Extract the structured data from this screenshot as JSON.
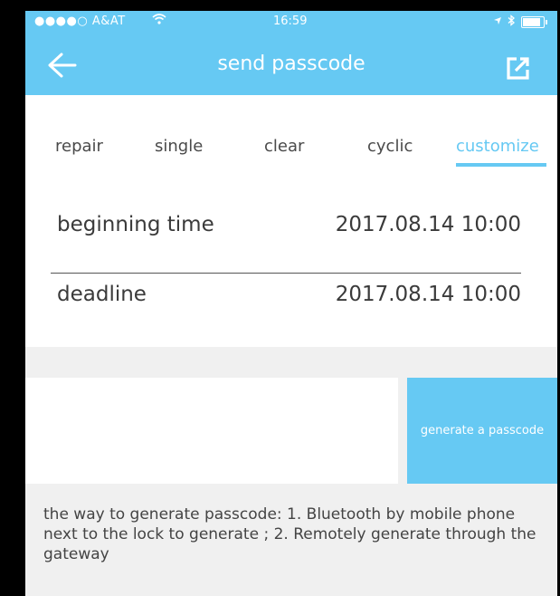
{
  "status_bar": {
    "carrier": "●●●●○ A&AT",
    "time": "16:59"
  },
  "nav": {
    "title": "send passcode"
  },
  "tabs": [
    {
      "label": "repair"
    },
    {
      "label": "single"
    },
    {
      "label": "clear"
    },
    {
      "label": "cyclic"
    },
    {
      "label": "customize",
      "active": true
    }
  ],
  "time_card": {
    "beginning_label": "beginning time",
    "beginning_value": "2017.08.14 10:00",
    "deadline_label": "deadline",
    "deadline_value": "2017.08.14 10:00"
  },
  "generate_button": "generate a passcode",
  "note": "the way to  generate passcode: 1. Bluetooth by mobile phone next to the lock to generate ; 2. Remotely generate through the gateway",
  "colors": {
    "accent": "#66c9f3",
    "text": "#3a3a3a"
  }
}
